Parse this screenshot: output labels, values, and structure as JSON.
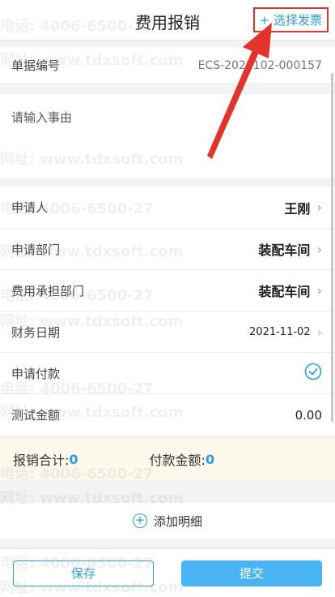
{
  "header": {
    "title": "费用报销",
    "select_invoice": "+ 选择发票"
  },
  "doc_no": {
    "label": "单据编号",
    "value": "ECS-2021102-000157"
  },
  "reason_placeholder": "请输入事由",
  "fields": {
    "applicant": {
      "label": "申请人",
      "value": "王刚"
    },
    "department": {
      "label": "申请部门",
      "value": "装配车间"
    },
    "cost_department": {
      "label": "费用承担部门",
      "value": "装配车间"
    },
    "finance_date": {
      "label": "财务日期",
      "value": "2021-11-02"
    },
    "apply_payment": {
      "label": "申请付款"
    },
    "test_amount": {
      "label": "测试金额",
      "value": "0.00"
    }
  },
  "summary": {
    "total_label": "报销合计:",
    "total_value": "0",
    "pay_label": "付款金额:",
    "pay_value": "0"
  },
  "add_detail": "添加明细",
  "buttons": {
    "save": "保存",
    "submit": "提交"
  },
  "watermark": {
    "phone": "电话: 4006-6500-27",
    "site": "网址: www.tdxsoft.com"
  },
  "colors": {
    "accent": "#2f9ce0",
    "highlight": "#e0362f",
    "submit_bg": "#49b4f4"
  }
}
